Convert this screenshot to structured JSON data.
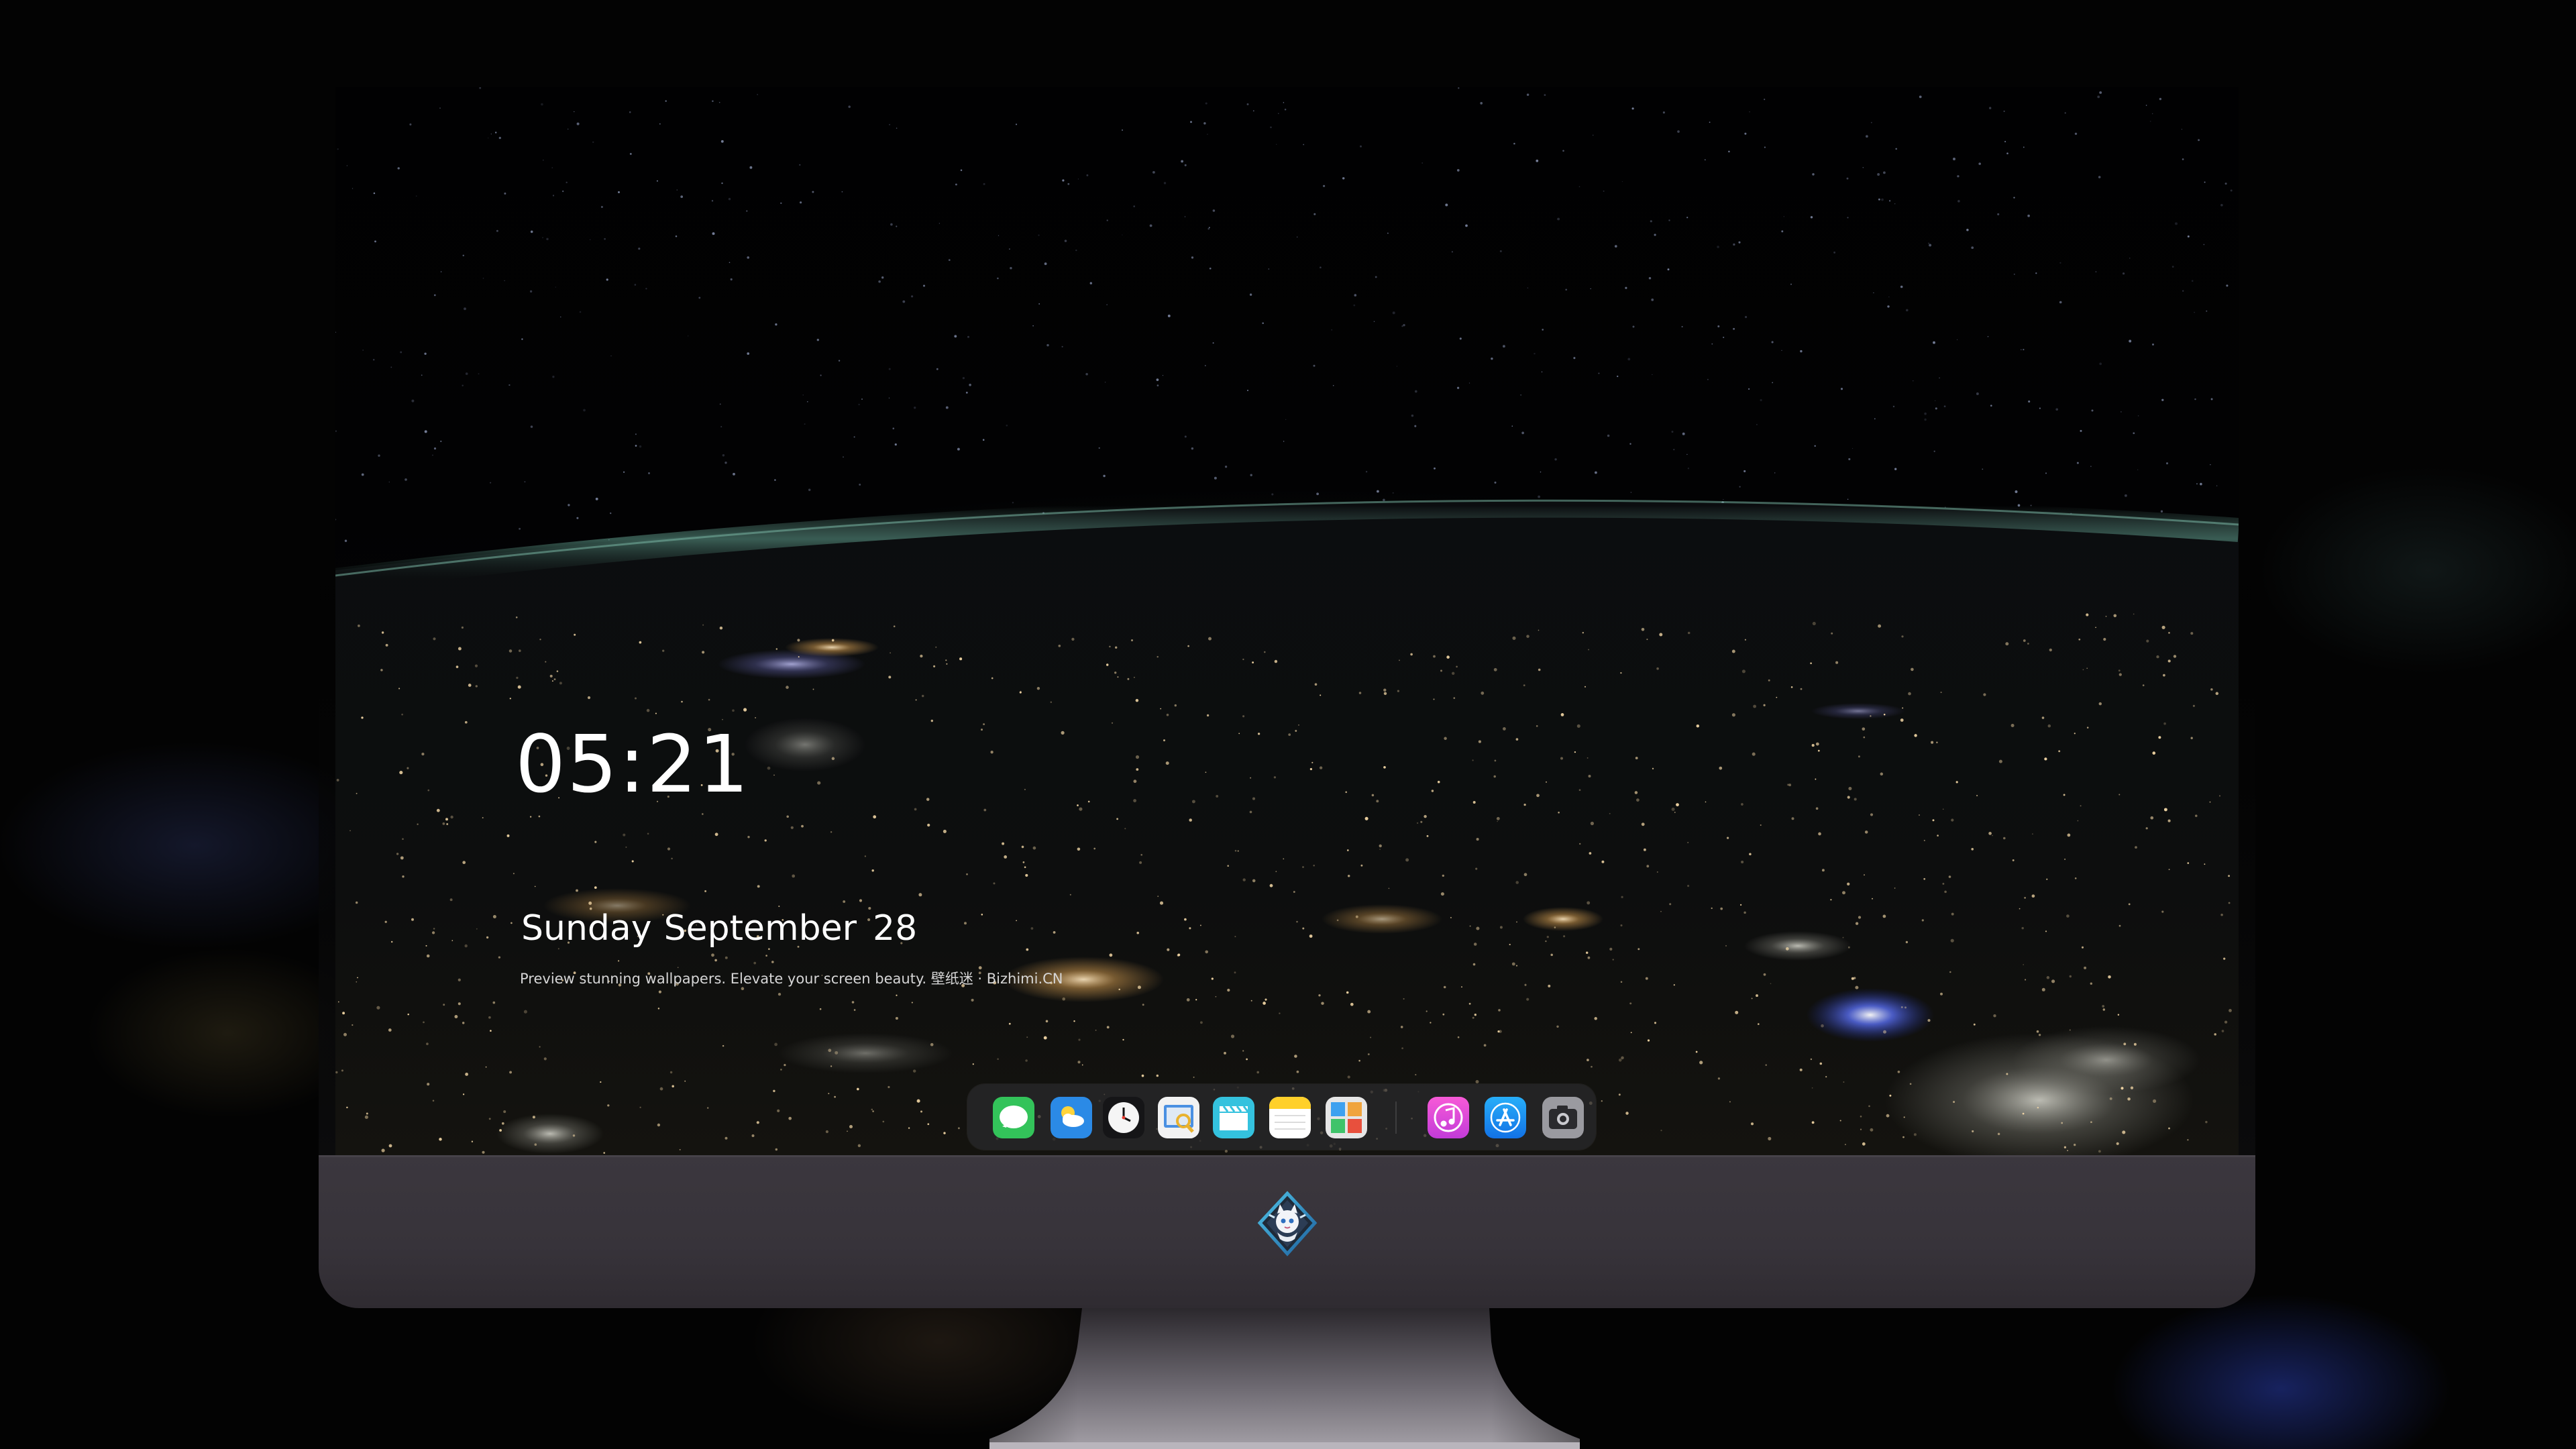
{
  "lock_screen": {
    "time": "05:21",
    "date_day": "Sunday",
    "date_month": "September",
    "date_number": "28",
    "tagline": "Preview stunning wallpapers. Elevate your screen beauty. 壁纸迷 · Bizhimi.CN"
  },
  "dock": {
    "apps": [
      {
        "name": "Messages",
        "icon": "messages-icon",
        "color": "#34c759"
      },
      {
        "name": "Weather",
        "icon": "weather-icon",
        "color": "#2f8ce8"
      },
      {
        "name": "Clock",
        "icon": "clock-icon",
        "color": "#1c1c1e"
      },
      {
        "name": "Preview",
        "icon": "preview-icon",
        "color": "#f3f3f3"
      },
      {
        "name": "Clips",
        "icon": "clapperboard-icon",
        "color": "#3bc6e3"
      },
      {
        "name": "Notes",
        "icon": "notes-icon",
        "color": "#ffd33d"
      },
      {
        "name": "Photo Booth",
        "icon": "photo-booth-icon",
        "color": "#e8e8e8"
      },
      {
        "name": "Music",
        "icon": "music-icon",
        "color": "#f04bd6"
      },
      {
        "name": "App Store",
        "icon": "app-store-icon",
        "color": "#1e90f5"
      },
      {
        "name": "Camera",
        "icon": "camera-icon",
        "color": "#8e8e93"
      }
    ]
  },
  "monitor": {
    "logo": "mascot-logo-icon",
    "frame_color": "#38343b"
  }
}
